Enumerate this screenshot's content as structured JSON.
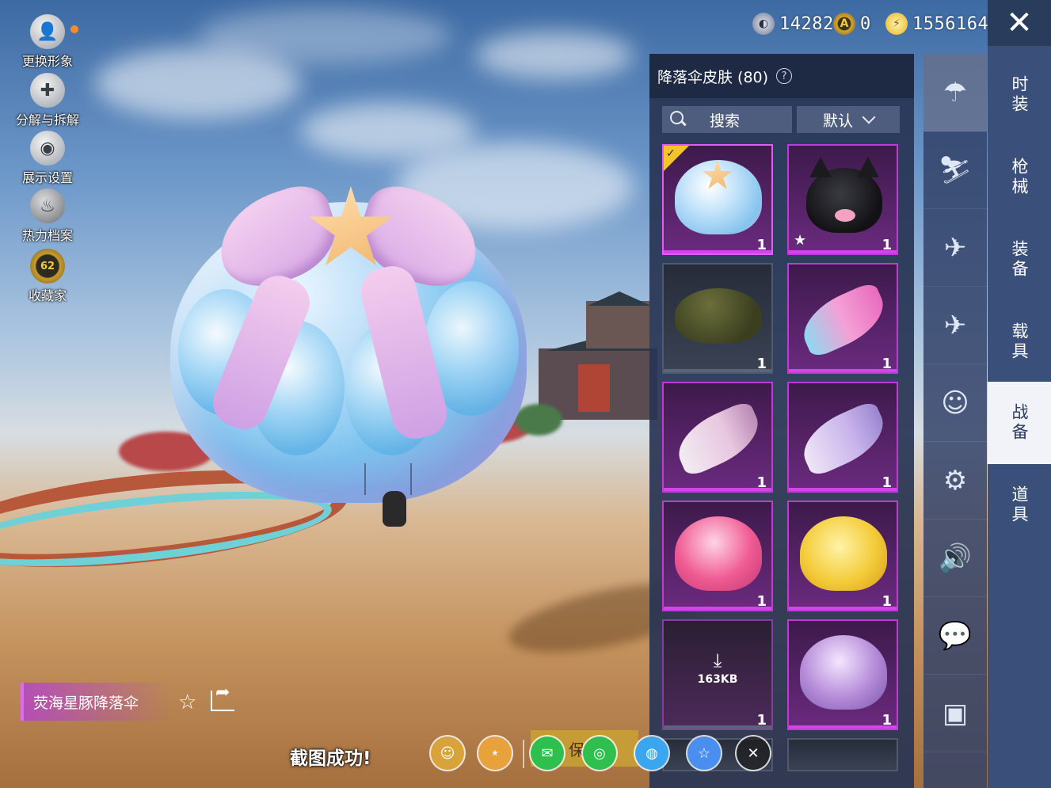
{
  "currencies": [
    {
      "icon": "silver-coin-icon",
      "value": "14282"
    },
    {
      "icon": "gold-badge-coin-icon",
      "value": "0"
    },
    {
      "icon": "uc-coin-icon",
      "value": "1556164"
    }
  ],
  "left_menu": [
    {
      "icon": "avatar-icon",
      "label": "更换形象"
    },
    {
      "icon": "puzzle-icon",
      "label": "分解与拆解"
    },
    {
      "icon": "eye-icon",
      "label": "展示设置"
    },
    {
      "icon": "flame-icon",
      "label": "热力档案"
    },
    {
      "icon": "collector-badge-icon",
      "label": "收藏家",
      "badge": "62"
    }
  ],
  "panel": {
    "title": "降落伞皮肤 (80)",
    "help": "?",
    "search_label": "搜索",
    "sort_label": "默认"
  },
  "items": [
    {
      "count": "1",
      "selected": true,
      "theme": "purple",
      "art": "jellyfish-bow"
    },
    {
      "count": "1",
      "favorite": true,
      "theme": "purple",
      "art": "black-cat"
    },
    {
      "count": "1",
      "theme": "dark",
      "art": "olive-default"
    },
    {
      "count": "1",
      "theme": "purple",
      "art": "pink-wing"
    },
    {
      "count": "1",
      "theme": "purple",
      "art": "white-fan"
    },
    {
      "count": "1",
      "theme": "purple",
      "art": "lavender-fan"
    },
    {
      "count": "1",
      "theme": "purple",
      "art": "pink-carnival"
    },
    {
      "count": "1",
      "theme": "purple",
      "art": "yellow-duck"
    },
    {
      "count": "1",
      "theme": "dark",
      "art": "download",
      "download_size": "163KB"
    },
    {
      "count": "1",
      "theme": "purple",
      "art": "purple-cupid"
    }
  ],
  "category_icons": [
    {
      "icon": "parachute-icon",
      "active": true
    },
    {
      "icon": "skydiver-icon"
    },
    {
      "icon": "drone-icon"
    },
    {
      "icon": "airplane-icon"
    },
    {
      "icon": "emote-face-icon"
    },
    {
      "icon": "robot-icon"
    },
    {
      "icon": "speaker-icon"
    },
    {
      "icon": "chat-bubble-icon"
    },
    {
      "icon": "photo-icon"
    }
  ],
  "tabs": [
    {
      "label": "时装"
    },
    {
      "label": "枪械"
    },
    {
      "label": "装备"
    },
    {
      "label": "载具"
    },
    {
      "label": "战备",
      "active": true
    },
    {
      "label": "道具"
    }
  ],
  "skin_name": "荧海星豚降落伞",
  "toast": "截图成功!",
  "share": {
    "save_label": "保存"
  },
  "colors": {
    "rarity_purple": "#c23ad6",
    "tab_bg": "#3a4f7a",
    "panel_bg": "#28345a",
    "gold": "#f3c52a"
  }
}
